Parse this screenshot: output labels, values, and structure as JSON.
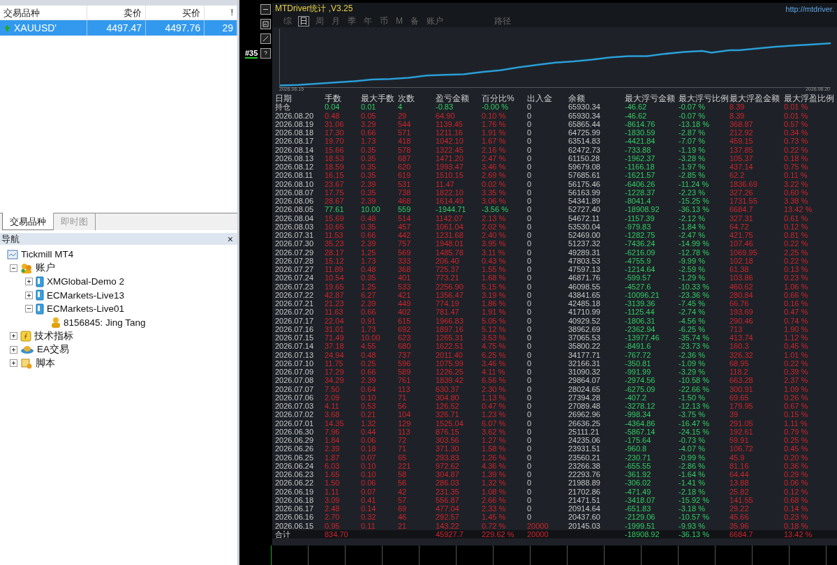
{
  "market_watch": {
    "columns": [
      "交易品种",
      "卖价",
      "买价",
      "!"
    ],
    "rows": [
      {
        "symbol": "XAUUSD'",
        "bid": "4497.47",
        "ask": "4497.76",
        "spread": "29",
        "selected": true
      }
    ]
  },
  "bottom_tabs": [
    {
      "label": "交易品种",
      "selected": true
    },
    {
      "label": "即时图",
      "selected": false
    }
  ],
  "navigator": {
    "title": "导航",
    "close": "×",
    "tree": [
      {
        "label": "Tickmill MT4",
        "kind": "terminal",
        "children": [
          {
            "label": "账户",
            "kind": "accounts",
            "expanded": true,
            "children": [
              {
                "label": "XMGlobal-Demo 2",
                "kind": "server",
                "expanded": false
              },
              {
                "label": "ECMarkets-Live13",
                "kind": "server",
                "expanded": false
              },
              {
                "label": "ECMarkets-Live01",
                "kind": "server",
                "expanded": true,
                "children": [
                  {
                    "label": "8156845: Jing Tang",
                    "kind": "user"
                  }
                ]
              }
            ]
          },
          {
            "label": "技术指标",
            "kind": "indicator",
            "expanded": false
          },
          {
            "label": "EA交易",
            "kind": "ea",
            "expanded": false
          },
          {
            "label": "脚本",
            "kind": "script",
            "expanded": false
          }
        ]
      }
    ]
  },
  "chart_label": "#35",
  "stats": {
    "title": "MTDriver统计 ,V3.25",
    "link": "http://mtdriver.",
    "tabs": [
      {
        "label": "综",
        "selected": false
      },
      {
        "label": "日",
        "selected": true
      },
      {
        "label": "周",
        "selected": false
      },
      {
        "label": "月",
        "selected": false
      },
      {
        "label": "季",
        "selected": false
      },
      {
        "label": "年",
        "selected": false
      },
      {
        "label": "币",
        "selected": false
      },
      {
        "label": "M",
        "selected": false
      },
      {
        "label": "备",
        "selected": false
      },
      {
        "label": "账户",
        "selected": false
      }
    ],
    "path_label": "路径",
    "equity_start": "2026.06.15",
    "equity_end": "2026.08.20",
    "columns": [
      "日期",
      "手数",
      "最大手数",
      "次数",
      "盈亏金额",
      "百分比%",
      "出入金",
      "余额",
      "最大浮亏金额",
      "最大浮亏比例",
      "最大浮盈金额",
      "最大浮盈比例"
    ],
    "rows": [
      {
        "loss": true,
        "cells": [
          "持仓",
          "0.04",
          "0.01",
          "4",
          "-0.83",
          "-0.00 %",
          "0",
          "65930.34",
          "-46.62",
          "-0.07 %",
          "8.39",
          "0.01 %"
        ]
      },
      {
        "loss": false,
        "cells": [
          "2026.08.20",
          "0.48",
          "0.05",
          "29",
          "64.90",
          "0.10 %",
          "0",
          "65930.34",
          "-46.62",
          "-0.07 %",
          "8.39",
          "0.01 %"
        ]
      },
      {
        "loss": false,
        "cells": [
          "2026.08.19",
          "31.06",
          "3.29",
          "544",
          "1139.45",
          "1.76 %",
          "0",
          "65865.44",
          "-8614.76",
          "-13.18 %",
          "368.87",
          "0.57 %"
        ]
      },
      {
        "loss": false,
        "cells": [
          "2026.08.18",
          "17.30",
          "0.66",
          "571",
          "1211.16",
          "1.91 %",
          "0",
          "64725.99",
          "-1830.59",
          "-2.87 %",
          "212.92",
          "0.34 %"
        ]
      },
      {
        "loss": false,
        "cells": [
          "2026.08.17",
          "19.70",
          "1.73",
          "418",
          "1042.10",
          "1.67 %",
          "0",
          "63514.83",
          "-4421.84",
          "-7.07 %",
          "459.15",
          "0.73 %"
        ]
      },
      {
        "loss": false,
        "cells": [
          "2026.08.14",
          "15.66",
          "0.35",
          "578",
          "1322.45",
          "2.16 %",
          "0",
          "62472.73",
          "-733.88",
          "-1.19 %",
          "137.85",
          "0.22 %"
        ]
      },
      {
        "loss": false,
        "cells": [
          "2026.08.13",
          "18.53",
          "0.35",
          "687",
          "1471.20",
          "2.47 %",
          "0",
          "61150.28",
          "-1962.37",
          "-3.28 %",
          "105.37",
          "0.18 %"
        ]
      },
      {
        "loss": false,
        "cells": [
          "2026.08.12",
          "18.59",
          "0.35",
          "620",
          "1993.47",
          "3.46 %",
          "0",
          "59679.08",
          "-1166.18",
          "-1.97 %",
          "437.14",
          "0.75 %"
        ]
      },
      {
        "loss": false,
        "cells": [
          "2026.08.11",
          "16.15",
          "0.35",
          "619",
          "1510.15",
          "2.69 %",
          "0",
          "57685.61",
          "-1621.57",
          "-2.85 %",
          "62.2",
          "0.11 %"
        ]
      },
      {
        "loss": false,
        "cells": [
          "2026.08.10",
          "23.67",
          "2.39",
          "531",
          "11.47",
          "0.02 %",
          "0",
          "56175.46",
          "-6406.26",
          "-11.24 %",
          "1836.69",
          "3.22 %"
        ]
      },
      {
        "loss": false,
        "cells": [
          "2026.08.07",
          "17.75",
          "0.35",
          "738",
          "1822.10",
          "3.35 %",
          "0",
          "56163.99",
          "-1228.37",
          "-2.23 %",
          "327.26",
          "0.60 %"
        ]
      },
      {
        "loss": false,
        "cells": [
          "2026.08.06",
          "28.67",
          "2.39",
          "468",
          "1614.49",
          "3.06 %",
          "0",
          "54341.89",
          "-8041.4",
          "-15.25 %",
          "1731.55",
          "3.38 %"
        ]
      },
      {
        "loss": true,
        "cells": [
          "2026.08.05",
          "77.61",
          "10.00",
          "559",
          "-1944.71",
          "-3.56 %",
          "0",
          "52727.40",
          "-18908.92",
          "-36.13 %",
          "6684.7",
          "13.42 %"
        ]
      },
      {
        "loss": false,
        "cells": [
          "2026.08.04",
          "15.69",
          "0.48",
          "514",
          "1142.07",
          "2.13 %",
          "0",
          "54672.11",
          "-1157.39",
          "-2.12 %",
          "327.31",
          "0.61 %"
        ]
      },
      {
        "loss": false,
        "cells": [
          "2026.08.03",
          "10.65",
          "0.35",
          "457",
          "1061.04",
          "2.02 %",
          "0",
          "53530.04",
          "-979.83",
          "-1.84 %",
          "64.72",
          "0.12 %"
        ]
      },
      {
        "loss": false,
        "cells": [
          "2026.07.31",
          "11.53",
          "0.66",
          "442",
          "1231.68",
          "2.40 %",
          "0",
          "52469.00",
          "-1282.75",
          "-2.47 %",
          "421.75",
          "0.81 %"
        ]
      },
      {
        "loss": false,
        "cells": [
          "2026.07.30",
          "35.23",
          "2.39",
          "757",
          "1948.01",
          "3.95 %",
          "0",
          "51237.32",
          "-7436.24",
          "-14.99 %",
          "107.46",
          "0.22 %"
        ]
      },
      {
        "loss": false,
        "cells": [
          "2026.07.29",
          "28.17",
          "1.25",
          "569",
          "1485.78",
          "3.11 %",
          "0",
          "49289.31",
          "-6216.09",
          "-12.78 %",
          "1069.95",
          "2.25 %"
        ]
      },
      {
        "loss": false,
        "cells": [
          "2026.07.28",
          "15.12",
          "1.73",
          "333",
          "206.40",
          "0.43 %",
          "0",
          "47803.53",
          "-4755.9",
          "-9.99 %",
          "102.18",
          "0.22 %"
        ]
      },
      {
        "loss": false,
        "cells": [
          "2026.07.27",
          "11.89",
          "0.48",
          "368",
          "725.37",
          "1.55 %",
          "0",
          "47597.13",
          "-1214.64",
          "-2.59 %",
          "61.38",
          "0.13 %"
        ]
      },
      {
        "loss": false,
        "cells": [
          "2026.07.24",
          "10.54",
          "0.35",
          "401",
          "773.21",
          "1.68 %",
          "0",
          "46871.76",
          "-599.57",
          "-1.29 %",
          "103.86",
          "0.23 %"
        ]
      },
      {
        "loss": false,
        "cells": [
          "2026.07.23",
          "19.65",
          "1.25",
          "533",
          "2256.90",
          "5.15 %",
          "0",
          "46098.55",
          "-4527.6",
          "-10.33 %",
          "460.62",
          "1.06 %"
        ]
      },
      {
        "loss": false,
        "cells": [
          "2026.07.22",
          "42.87",
          "6.27",
          "421",
          "1356.47",
          "3.19 %",
          "0",
          "43841.65",
          "-10096.21",
          "-23.36 %",
          "280.84",
          "0.66 %"
        ]
      },
      {
        "loss": false,
        "cells": [
          "2026.07.21",
          "21.23",
          "2.39",
          "449",
          "774.19",
          "1.86 %",
          "0",
          "42485.18",
          "-3139.36",
          "-7.45 %",
          "66.76",
          "0.16 %"
        ]
      },
      {
        "loss": false,
        "cells": [
          "2026.07.20",
          "11.63",
          "0.66",
          "402",
          "781.47",
          "1.91 %",
          "0",
          "41710.99",
          "-1125.44",
          "-2.74 %",
          "193.69",
          "0.47 %"
        ]
      },
      {
        "loss": false,
        "cells": [
          "2026.07.17",
          "22.04",
          "0.91",
          "615",
          "1966.83",
          "5.05 %",
          "0",
          "40929.52",
          "-1806.31",
          "-4.56 %",
          "290.46",
          "0.74 %"
        ]
      },
      {
        "loss": false,
        "cells": [
          "2026.07.16",
          "31.01",
          "1.73",
          "692",
          "1897.16",
          "5.12 %",
          "0",
          "38962.69",
          "-2362.94",
          "-6.25 %",
          "713",
          "1.90 %"
        ]
      },
      {
        "loss": false,
        "cells": [
          "2026.07.15",
          "71.49",
          "10.00",
          "623",
          "1265.31",
          "3.53 %",
          "0",
          "37065.53",
          "-13977.46",
          "-35.74 %",
          "413.74",
          "1.12 %"
        ]
      },
      {
        "loss": false,
        "cells": [
          "2026.07.14",
          "37.18",
          "4.55",
          "680",
          "1622.51",
          "4.75 %",
          "0",
          "35800.22",
          "-8491.6",
          "-23.73 %",
          "160.3",
          "0.45 %"
        ]
      },
      {
        "loss": false,
        "cells": [
          "2026.07.13",
          "24.94",
          "0.48",
          "737",
          "2011.40",
          "6.25 %",
          "0",
          "34177.71",
          "-767.72",
          "-2.36 %",
          "326.32",
          "1.01 %"
        ]
      },
      {
        "loss": false,
        "cells": [
          "2026.07.10",
          "11.75",
          "0.25",
          "596",
          "1075.99",
          "3.46 %",
          "0",
          "32166.31",
          "-350.81",
          "-1.09 %",
          "68.95",
          "0.22 %"
        ]
      },
      {
        "loss": false,
        "cells": [
          "2026.07.09",
          "17.29",
          "0.66",
          "589",
          "1226.25",
          "4.11 %",
          "0",
          "31090.32",
          "-991.99",
          "-3.29 %",
          "118.2",
          "0.39 %"
        ]
      },
      {
        "loss": false,
        "cells": [
          "2026.07.08",
          "34.29",
          "2.39",
          "761",
          "1839.42",
          "6.56 %",
          "0",
          "29864.07",
          "-2974.56",
          "-10.58 %",
          "663.28",
          "2.37 %"
        ]
      },
      {
        "loss": false,
        "cells": [
          "2026.07.07",
          "7.50",
          "0.64",
          "113",
          "630.37",
          "2.30 %",
          "0",
          "28024.65",
          "-6275.09",
          "-22.66 %",
          "300.91",
          "1.09 %"
        ]
      },
      {
        "loss": false,
        "cells": [
          "2026.07.06",
          "2.09",
          "0.10",
          "71",
          "304.80",
          "1.13 %",
          "0",
          "27394.28",
          "-407.2",
          "-1.50 %",
          "69.65",
          "0.26 %"
        ]
      },
      {
        "loss": false,
        "cells": [
          "2026.07.03",
          "4.11",
          "0.53",
          "56",
          "126.52",
          "0.47 %",
          "0",
          "27089.48",
          "-3278.12",
          "-12.13 %",
          "179.95",
          "0.67 %"
        ]
      },
      {
        "loss": false,
        "cells": [
          "2026.07.02",
          "3.68",
          "0.21",
          "104",
          "326.71",
          "1.23 %",
          "0",
          "26962.96",
          "-998.34",
          "-3.75 %",
          "39",
          "0.15 %"
        ]
      },
      {
        "loss": false,
        "cells": [
          "2026.07.01",
          "14.35",
          "1.32",
          "129",
          "1525.04",
          "6.07 %",
          "0",
          "26636.25",
          "-4364.86",
          "-16.47 %",
          "291.05",
          "1.11 %"
        ]
      },
      {
        "loss": false,
        "cells": [
          "2026.06.30",
          "7.96",
          "0.44",
          "113",
          "876.15",
          "3.62 %",
          "0",
          "25111.21",
          "-5867.14",
          "-24.15 %",
          "192.61",
          "0.79 %"
        ]
      },
      {
        "loss": false,
        "cells": [
          "2026.06.29",
          "1.84",
          "0.06",
          "72",
          "303.56",
          "1.27 %",
          "0",
          "24235.06",
          "-175.64",
          "-0.73 %",
          "59.91",
          "0.25 %"
        ]
      },
      {
        "loss": false,
        "cells": [
          "2026.06.26",
          "2.39",
          "0.18",
          "71",
          "371.30",
          "1.58 %",
          "0",
          "23931.51",
          "-960.8",
          "-4.07 %",
          "106.72",
          "0.45 %"
        ]
      },
      {
        "loss": false,
        "cells": [
          "2026.06.25",
          "1.87",
          "0.07",
          "65",
          "293.83",
          "1.26 %",
          "0",
          "23560.21",
          "-230.71",
          "-0.99 %",
          "45.9",
          "0.20 %"
        ]
      },
      {
        "loss": false,
        "cells": [
          "2026.06.24",
          "6.03",
          "0.10",
          "221",
          "972.62",
          "4.36 %",
          "0",
          "23266.38",
          "-655.55",
          "-2.86 %",
          "81.16",
          "0.36 %"
        ]
      },
      {
        "loss": false,
        "cells": [
          "2026.06.23",
          "1.65",
          "0.10",
          "58",
          "304.87",
          "1.39 %",
          "0",
          "22293.76",
          "-361.92",
          "-1.64 %",
          "64.44",
          "0.29 %"
        ]
      },
      {
        "loss": false,
        "cells": [
          "2026.06.22",
          "1.50",
          "0.06",
          "56",
          "286.03",
          "1.32 %",
          "0",
          "21988.89",
          "-306.02",
          "-1.41 %",
          "13.88",
          "0.06 %"
        ]
      },
      {
        "loss": false,
        "cells": [
          "2026.06.19",
          "1.11",
          "0.07",
          "42",
          "231.35",
          "1.08 %",
          "0",
          "21702.86",
          "-471.49",
          "-2.18 %",
          "25.82",
          "0.12 %"
        ]
      },
      {
        "loss": false,
        "cells": [
          "2026.06.18",
          "3.09",
          "0.41",
          "57",
          "556.87",
          "2.66 %",
          "0",
          "21471.51",
          "-3418.07",
          "-15.92 %",
          "141.55",
          "0.68 %"
        ]
      },
      {
        "loss": false,
        "cells": [
          "2026.06.17",
          "2.48",
          "0.14",
          "69",
          "477.04",
          "2.33 %",
          "0",
          "20914.64",
          "-651.83",
          "-3.18 %",
          "29.22",
          "0.14 %"
        ]
      },
      {
        "loss": false,
        "cells": [
          "2026.06.16",
          "2.70",
          "0.32",
          "46",
          "292.57",
          "1.45 %",
          "0",
          "20437.60",
          "-2129.06",
          "-10.57 %",
          "45.66",
          "0.23 %"
        ]
      },
      {
        "loss": false,
        "cells": [
          "2026.06.15",
          "0.95",
          "0.11",
          "21",
          "143.22",
          "0.72 %",
          "20000",
          "20145.03",
          "-1999.51",
          "-9.93 %",
          "35.96",
          "0.18 %"
        ]
      }
    ],
    "total": {
      "cells": [
        "合计",
        "834.70",
        null,
        null,
        "45927.7",
        "229.62 %",
        "20000",
        null,
        "-18908.92",
        "-36.13 %",
        "6684.7",
        "13.42 %"
      ]
    }
  }
}
